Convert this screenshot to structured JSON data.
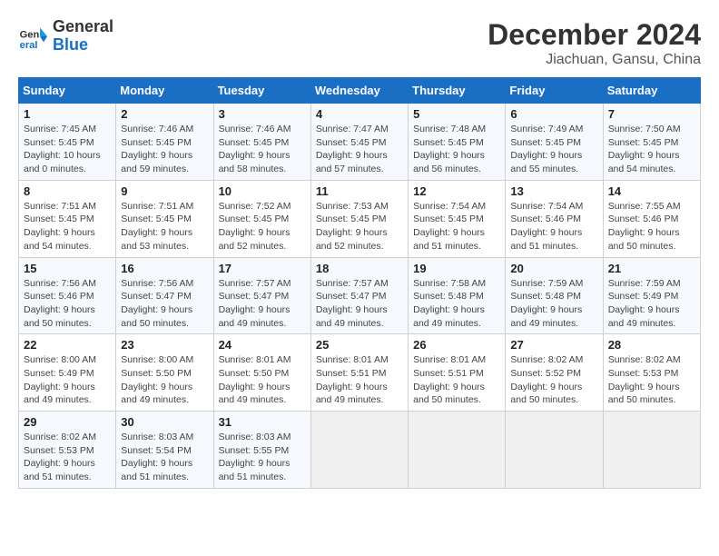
{
  "header": {
    "logo_line1": "General",
    "logo_line2": "Blue",
    "month": "December 2024",
    "location": "Jiachuan, Gansu, China"
  },
  "days_of_week": [
    "Sunday",
    "Monday",
    "Tuesday",
    "Wednesday",
    "Thursday",
    "Friday",
    "Saturday"
  ],
  "weeks": [
    [
      {
        "day": "1",
        "detail": "Sunrise: 7:45 AM\nSunset: 5:45 PM\nDaylight: 10 hours\nand 0 minutes."
      },
      {
        "day": "2",
        "detail": "Sunrise: 7:46 AM\nSunset: 5:45 PM\nDaylight: 9 hours\nand 59 minutes."
      },
      {
        "day": "3",
        "detail": "Sunrise: 7:46 AM\nSunset: 5:45 PM\nDaylight: 9 hours\nand 58 minutes."
      },
      {
        "day": "4",
        "detail": "Sunrise: 7:47 AM\nSunset: 5:45 PM\nDaylight: 9 hours\nand 57 minutes."
      },
      {
        "day": "5",
        "detail": "Sunrise: 7:48 AM\nSunset: 5:45 PM\nDaylight: 9 hours\nand 56 minutes."
      },
      {
        "day": "6",
        "detail": "Sunrise: 7:49 AM\nSunset: 5:45 PM\nDaylight: 9 hours\nand 55 minutes."
      },
      {
        "day": "7",
        "detail": "Sunrise: 7:50 AM\nSunset: 5:45 PM\nDaylight: 9 hours\nand 54 minutes."
      }
    ],
    [
      {
        "day": "8",
        "detail": "Sunrise: 7:51 AM\nSunset: 5:45 PM\nDaylight: 9 hours\nand 54 minutes."
      },
      {
        "day": "9",
        "detail": "Sunrise: 7:51 AM\nSunset: 5:45 PM\nDaylight: 9 hours\nand 53 minutes."
      },
      {
        "day": "10",
        "detail": "Sunrise: 7:52 AM\nSunset: 5:45 PM\nDaylight: 9 hours\nand 52 minutes."
      },
      {
        "day": "11",
        "detail": "Sunrise: 7:53 AM\nSunset: 5:45 PM\nDaylight: 9 hours\nand 52 minutes."
      },
      {
        "day": "12",
        "detail": "Sunrise: 7:54 AM\nSunset: 5:45 PM\nDaylight: 9 hours\nand 51 minutes."
      },
      {
        "day": "13",
        "detail": "Sunrise: 7:54 AM\nSunset: 5:46 PM\nDaylight: 9 hours\nand 51 minutes."
      },
      {
        "day": "14",
        "detail": "Sunrise: 7:55 AM\nSunset: 5:46 PM\nDaylight: 9 hours\nand 50 minutes."
      }
    ],
    [
      {
        "day": "15",
        "detail": "Sunrise: 7:56 AM\nSunset: 5:46 PM\nDaylight: 9 hours\nand 50 minutes."
      },
      {
        "day": "16",
        "detail": "Sunrise: 7:56 AM\nSunset: 5:47 PM\nDaylight: 9 hours\nand 50 minutes."
      },
      {
        "day": "17",
        "detail": "Sunrise: 7:57 AM\nSunset: 5:47 PM\nDaylight: 9 hours\nand 49 minutes."
      },
      {
        "day": "18",
        "detail": "Sunrise: 7:57 AM\nSunset: 5:47 PM\nDaylight: 9 hours\nand 49 minutes."
      },
      {
        "day": "19",
        "detail": "Sunrise: 7:58 AM\nSunset: 5:48 PM\nDaylight: 9 hours\nand 49 minutes."
      },
      {
        "day": "20",
        "detail": "Sunrise: 7:59 AM\nSunset: 5:48 PM\nDaylight: 9 hours\nand 49 minutes."
      },
      {
        "day": "21",
        "detail": "Sunrise: 7:59 AM\nSunset: 5:49 PM\nDaylight: 9 hours\nand 49 minutes."
      }
    ],
    [
      {
        "day": "22",
        "detail": "Sunrise: 8:00 AM\nSunset: 5:49 PM\nDaylight: 9 hours\nand 49 minutes."
      },
      {
        "day": "23",
        "detail": "Sunrise: 8:00 AM\nSunset: 5:50 PM\nDaylight: 9 hours\nand 49 minutes."
      },
      {
        "day": "24",
        "detail": "Sunrise: 8:01 AM\nSunset: 5:50 PM\nDaylight: 9 hours\nand 49 minutes."
      },
      {
        "day": "25",
        "detail": "Sunrise: 8:01 AM\nSunset: 5:51 PM\nDaylight: 9 hours\nand 49 minutes."
      },
      {
        "day": "26",
        "detail": "Sunrise: 8:01 AM\nSunset: 5:51 PM\nDaylight: 9 hours\nand 50 minutes."
      },
      {
        "day": "27",
        "detail": "Sunrise: 8:02 AM\nSunset: 5:52 PM\nDaylight: 9 hours\nand 50 minutes."
      },
      {
        "day": "28",
        "detail": "Sunrise: 8:02 AM\nSunset: 5:53 PM\nDaylight: 9 hours\nand 50 minutes."
      }
    ],
    [
      {
        "day": "29",
        "detail": "Sunrise: 8:02 AM\nSunset: 5:53 PM\nDaylight: 9 hours\nand 51 minutes."
      },
      {
        "day": "30",
        "detail": "Sunrise: 8:03 AM\nSunset: 5:54 PM\nDaylight: 9 hours\nand 51 minutes."
      },
      {
        "day": "31",
        "detail": "Sunrise: 8:03 AM\nSunset: 5:55 PM\nDaylight: 9 hours\nand 51 minutes."
      },
      null,
      null,
      null,
      null
    ]
  ]
}
